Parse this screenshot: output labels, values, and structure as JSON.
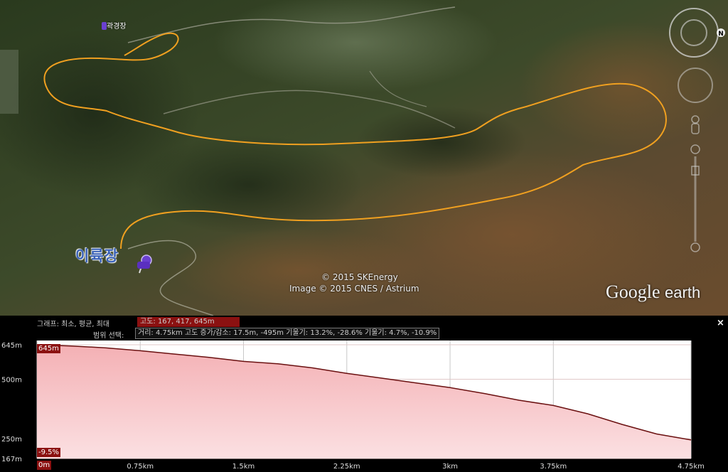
{
  "map": {
    "place_top": "곽경장",
    "place_main": "이륙장",
    "copyright_1": "© 2015 SKEnergy",
    "copyright_2": "Image © 2015 CNES / Astrium",
    "logo_google": "Google",
    "logo_earth": "earth",
    "compass_letter": "N",
    "colors": {
      "track": "#f0a020",
      "terrain_dark": "#2e3a22",
      "terrain_brown": "#6a4a2a"
    }
  },
  "panel": {
    "graph_label": "그래프: 최소, 평균, 최대",
    "altitude_readout": "고도: 167, 417, 645m",
    "range_label": "범위 선택:",
    "stats_readout": "거리: 4.75km 고도 증가/감소: 17.5m, -495m 기울기: 13.2%, -28.6% 기울기: 4.7%, -10.9%",
    "close": "×"
  },
  "chart_data": {
    "type": "area",
    "xlabel": "",
    "ylabel": "",
    "x_ticks": [
      "0m",
      "0.75km",
      "1.5km",
      "2.25km",
      "3km",
      "3.75km",
      "4.75km"
    ],
    "y_ticks": [
      "645m",
      "500m",
      "250m",
      "167m"
    ],
    "ylim": [
      167,
      645
    ],
    "xlim": [
      0,
      4.75
    ],
    "max_tag": "645m",
    "slope_tag": "-9.5%",
    "start_tag": "0m",
    "grid": true,
    "x": [
      0,
      0.25,
      0.5,
      0.75,
      1.0,
      1.25,
      1.5,
      1.75,
      2.0,
      2.25,
      2.5,
      2.75,
      3.0,
      3.25,
      3.5,
      3.75,
      4.0,
      4.25,
      4.5,
      4.75
    ],
    "y": [
      645,
      640,
      632,
      620,
      606,
      592,
      575,
      565,
      548,
      525,
      505,
      485,
      465,
      440,
      412,
      390,
      355,
      310,
      270,
      245
    ]
  }
}
